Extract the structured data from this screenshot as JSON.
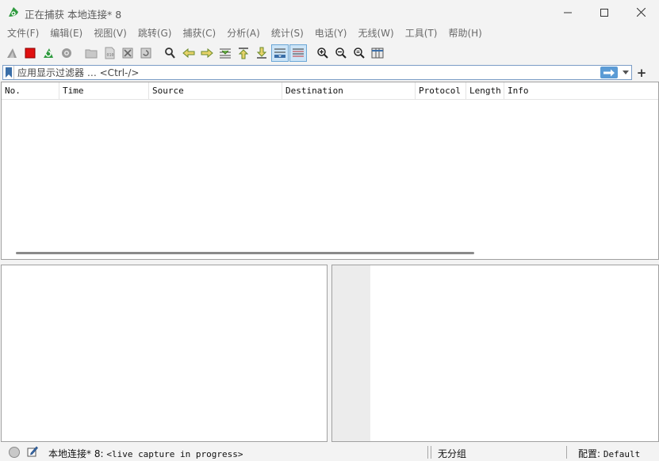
{
  "window": {
    "title": "正在捕获 本地连接* 8",
    "controls": [
      "minimize",
      "maximize",
      "close"
    ]
  },
  "menu": [
    "文件(F)",
    "编辑(E)",
    "视图(V)",
    "跳转(G)",
    "捕获(C)",
    "分析(A)",
    "统计(S)",
    "电话(Y)",
    "无线(W)",
    "工具(T)",
    "帮助(H)"
  ],
  "toolbar": {
    "buttons": [
      {
        "icon": "start-capture-icon"
      },
      {
        "icon": "stop-capture-icon"
      },
      {
        "icon": "restart-capture-icon"
      },
      {
        "icon": "capture-options-icon"
      },
      {
        "icon": "open-file-icon"
      },
      {
        "icon": "save-file-icon"
      },
      {
        "icon": "close-file-icon"
      },
      {
        "icon": "reload-file-icon"
      },
      {
        "icon": "find-packet-icon"
      },
      {
        "icon": "go-back-icon"
      },
      {
        "icon": "go-forward-icon"
      },
      {
        "icon": "go-to-packet-icon"
      },
      {
        "icon": "go-first-icon"
      },
      {
        "icon": "go-last-icon"
      },
      {
        "icon": "auto-scroll-icon"
      },
      {
        "icon": "colorize-icon"
      },
      {
        "icon": "zoom-in-icon"
      },
      {
        "icon": "zoom-out-icon"
      },
      {
        "icon": "zoom-normal-icon"
      },
      {
        "icon": "resize-columns-icon"
      }
    ]
  },
  "filter": {
    "placeholder": "应用显示过滤器 … <Ctrl-/>",
    "value": "",
    "add_label": "+"
  },
  "packet_list": {
    "columns": [
      "No.",
      "Time",
      "Source",
      "Destination",
      "Protocol",
      "Length",
      "Info"
    ],
    "rows": []
  },
  "status": {
    "capture_text": "本地连接* 8:",
    "capture_state": "<live capture in progress>",
    "group": "无分组",
    "profile_label": "配置:",
    "profile_value": "Default"
  },
  "colors": {
    "accent": "#5b9bd5",
    "stop_red": "#e01010",
    "shark_green": "#2e9a3e"
  }
}
